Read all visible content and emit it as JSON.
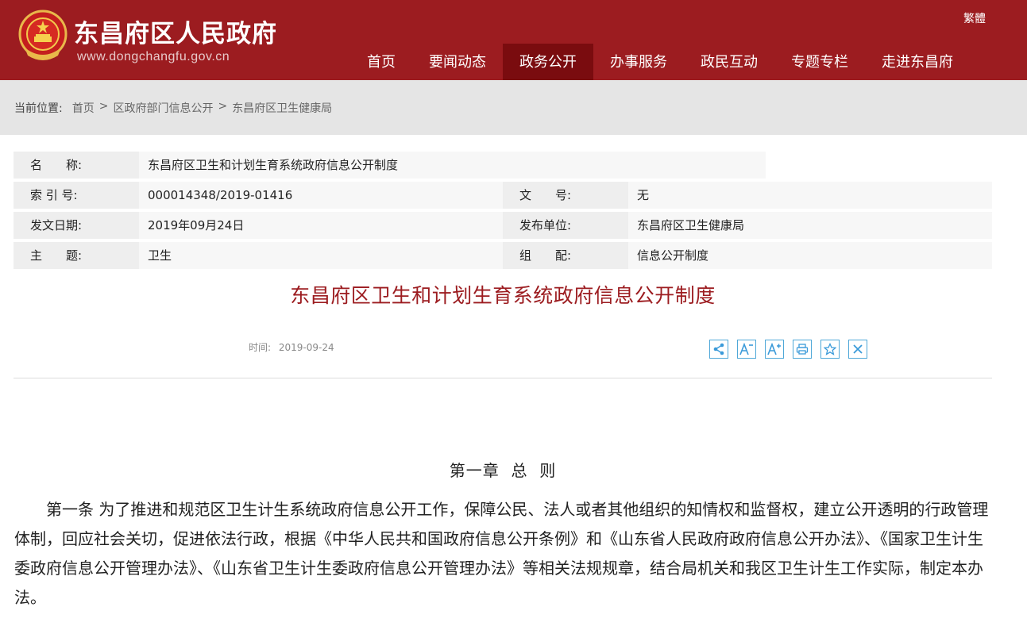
{
  "header": {
    "site_title": "东昌府区人民政府",
    "site_url": "www.dongchangfu.gov.cn",
    "lang_toggle": "繁體",
    "nav": [
      {
        "label": "首页",
        "active": false
      },
      {
        "label": "要闻动态",
        "active": false
      },
      {
        "label": "政务公开",
        "active": true
      },
      {
        "label": "办事服务",
        "active": false
      },
      {
        "label": "政民互动",
        "active": false
      },
      {
        "label": "专题专栏",
        "active": false
      },
      {
        "label": "走进东昌府",
        "active": false
      }
    ],
    "colors": {
      "brand": "#9c1c20",
      "nav_active": "#7a0c0f"
    }
  },
  "breadcrumb": {
    "label": "当前位置:",
    "items": [
      "首页",
      "区政府部门信息公开",
      "东昌府区卫生健康局"
    ],
    "separator": ">"
  },
  "info": {
    "name_label": "名　　称:",
    "name_value": "东昌府区卫生和计划生育系统政府信息公开制度",
    "index_label": "索 引 号:",
    "index_value": "000014348/2019-01416",
    "docno_label": "文　　号:",
    "docno_value": "无",
    "date_label": "发文日期:",
    "date_value": "2019年09月24日",
    "publisher_label": "发布单位:",
    "publisher_value": "东昌府区卫生健康局",
    "topic_label": "主　　题:",
    "topic_value": "卫生",
    "category_label": "组　　配:",
    "category_value": "信息公开制度"
  },
  "article": {
    "title": "东昌府区卫生和计划生育系统政府信息公开制度",
    "time_label": "时间:",
    "time_value": "2019-09-24",
    "tools": [
      "share-icon",
      "font-decrease-icon",
      "font-increase-icon",
      "print-icon",
      "favorite-icon",
      "close-icon"
    ],
    "chapter": "第一章  总  则",
    "paragraph": "第一条  为了推进和规范区卫生计生系统政府信息公开工作，保障公民、法人或者其他组织的知情权和监督权，建立公开透明的行政管理体制，回应社会关切，促进依法行政，根据《中华人民共和国政府信息公开条例》和《山东省人民政府政府信息公开办法》、《国家卫生计生委政府信息公开管理办法》、《山东省卫生计生委政府信息公开管理办法》等相关法规规章，结合局机关和我区卫生计生工作实际，制定本办法。"
  }
}
